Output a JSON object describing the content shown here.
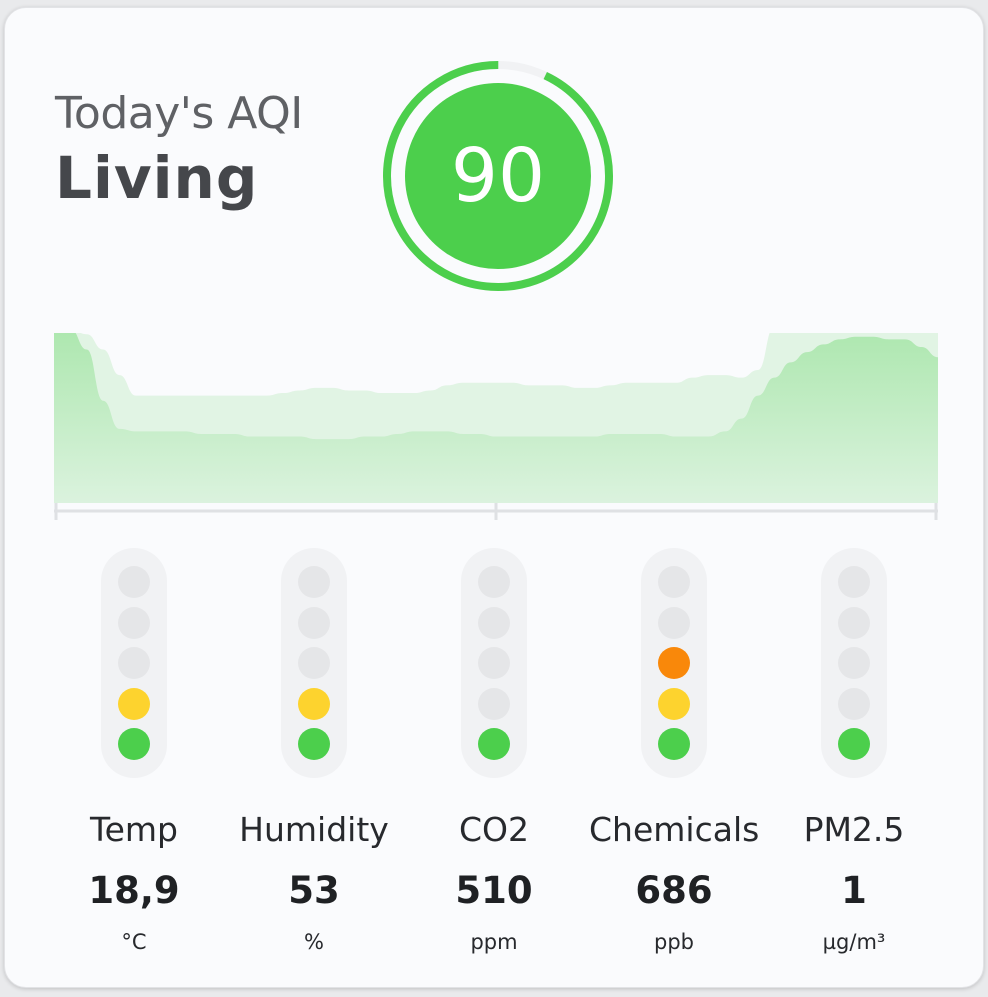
{
  "header": {
    "subtitle": "Today's AQI",
    "room": "Living"
  },
  "aqi": {
    "value": "90",
    "fraction": 0.93,
    "color": "#4ccf4c"
  },
  "history": {
    "front": [
      68,
      68,
      60,
      40,
      29,
      28,
      28,
      28,
      28,
      27,
      27,
      27,
      26,
      26,
      26,
      26,
      25,
      25,
      25,
      26,
      26,
      27,
      28,
      28,
      28,
      27,
      27,
      26,
      26,
      26,
      26,
      26,
      26,
      26,
      27,
      27,
      27,
      27,
      26,
      26,
      26,
      28,
      33,
      42,
      49,
      55,
      59,
      62,
      64,
      65,
      65,
      64,
      64,
      61,
      57
    ],
    "back": [
      68,
      68,
      66,
      60,
      50,
      42,
      42,
      42,
      42,
      42,
      42,
      42,
      42,
      42,
      43,
      44,
      45,
      45,
      44,
      44,
      43,
      43,
      43,
      44,
      46,
      47,
      47,
      47,
      47,
      46,
      46,
      46,
      45,
      45,
      46,
      47,
      47,
      47,
      47,
      49,
      50,
      50,
      49,
      52,
      69,
      72,
      75,
      77,
      78,
      79,
      78,
      78,
      80,
      81,
      82
    ]
  },
  "levels": {
    "colors": [
      "#4ccf4c",
      "#fdd32e",
      "#f9880a",
      "#e5e6e8"
    ]
  },
  "sensors": [
    {
      "label": "Temp",
      "value": "18,9",
      "unit": "°C",
      "level": 2
    },
    {
      "label": "Humidity",
      "value": "53",
      "unit": "%",
      "level": 2
    },
    {
      "label": "CO2",
      "value": "510",
      "unit": "ppm",
      "level": 1
    },
    {
      "label": "Chemicals",
      "value": "686",
      "unit": "ppb",
      "level": 3
    },
    {
      "label": "PM2.5",
      "value": "1",
      "unit": "µg/m³",
      "level": 1
    }
  ]
}
